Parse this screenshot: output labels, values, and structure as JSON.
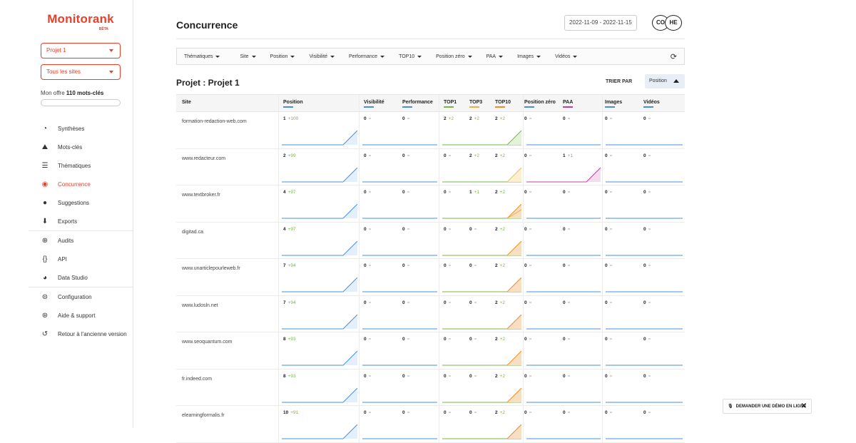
{
  "brand": {
    "name": "Monitorank",
    "badge": "BÊTA",
    "accent": "#e8402a"
  },
  "sidebar": {
    "project_select": "Projet 1",
    "sites_select": "Tous les sites",
    "offer_prefix": "Mon offre",
    "offer_value": "110 mots-clés",
    "items": [
      {
        "label": "Synthèses",
        "icon": "gauge-icon"
      },
      {
        "label": "Mots-clés",
        "icon": "mountain-icon"
      },
      {
        "label": "Thématiques",
        "icon": "layers-icon"
      },
      {
        "label": "Concurrence",
        "icon": "binoculars-icon",
        "active": true
      },
      {
        "label": "Suggestions",
        "icon": "lightbulb-icon"
      },
      {
        "label": "Exports",
        "icon": "download-icon"
      },
      {
        "label": "Audits",
        "icon": "crosshair-icon"
      },
      {
        "label": "API",
        "icon": "braces-icon"
      },
      {
        "label": "Data Studio",
        "icon": "pie-chart-icon"
      },
      {
        "label": "Configuration",
        "icon": "toggles-icon"
      },
      {
        "label": "Aide & support",
        "icon": "lifebuoy-icon"
      },
      {
        "label": "Retour à l'ancienne version",
        "icon": "undo-icon"
      }
    ]
  },
  "header": {
    "title": "Concurrence",
    "date_range": "2022-11-09 - 2022-11-15",
    "avatars": [
      "CO",
      "HE"
    ]
  },
  "filters": [
    "Thématiques",
    "Site",
    "Position",
    "Visibilité",
    "Performance",
    "TOP10",
    "Position zéro",
    "PAA",
    "Images",
    "Vidéos"
  ],
  "project": {
    "title": "Projet : Projet 1",
    "sort_label": "TRIER PAR",
    "sort_value": "Position"
  },
  "table": {
    "columns": [
      {
        "label": "Site",
        "color": ""
      },
      {
        "label": "Position",
        "color": "#4a90d9"
      },
      {
        "label": "Visibilité",
        "color": "#4a90d9"
      },
      {
        "label": "Performance",
        "color": "#4a90d9"
      },
      {
        "label": "TOP1",
        "color": "#7ab648"
      },
      {
        "label": "TOP3",
        "color": "#e8b04a"
      },
      {
        "label": "TOP10",
        "color": "#e8902a"
      },
      {
        "label": "Position zéro",
        "color": "#4a90d9"
      },
      {
        "label": "PAA",
        "color": "#c040a0"
      },
      {
        "label": "Images",
        "color": "#4a90d9"
      },
      {
        "label": "Vidéos",
        "color": "#4a90d9"
      }
    ],
    "rows": [
      {
        "site": "formation-redaction-web.com",
        "position": "1",
        "position_delta": "+100",
        "visibilite": "0",
        "performance": "0",
        "top1": "2",
        "top1_delta": "+2",
        "top3": "2",
        "top3_delta": "+2",
        "top10": "2",
        "top10_delta": "+2",
        "pos0": "0",
        "paa": "0",
        "paa_delta": "",
        "images": "0",
        "videos": "0",
        "top_fill": "green"
      },
      {
        "site": "www.redacteur.com",
        "position": "2",
        "position_delta": "+99",
        "visibilite": "0",
        "performance": "0",
        "top1": "0",
        "top1_delta": "",
        "top3": "2",
        "top3_delta": "+2",
        "top10": "2",
        "top10_delta": "+2",
        "pos0": "0",
        "paa": "1",
        "paa_delta": "+1",
        "images": "0",
        "videos": "0",
        "top_fill": "yellow"
      },
      {
        "site": "www.textbroker.fr",
        "position": "4",
        "position_delta": "+97",
        "visibilite": "0",
        "performance": "0",
        "top1": "0",
        "top1_delta": "",
        "top3": "1",
        "top3_delta": "+1",
        "top10": "2",
        "top10_delta": "+2",
        "pos0": "0",
        "paa": "0",
        "paa_delta": "",
        "images": "0",
        "videos": "0",
        "top_fill": "orange2"
      },
      {
        "site": "digitad.ca",
        "position": "4",
        "position_delta": "+97",
        "visibilite": "0",
        "performance": "0",
        "top1": "0",
        "top1_delta": "",
        "top3": "0",
        "top3_delta": "",
        "top10": "2",
        "top10_delta": "+2",
        "pos0": "0",
        "paa": "0",
        "paa_delta": "",
        "images": "0",
        "videos": "0",
        "top_fill": "orange"
      },
      {
        "site": "www.unarticlepourleweb.fr",
        "position": "7",
        "position_delta": "+94",
        "visibilite": "0",
        "performance": "0",
        "top1": "0",
        "top1_delta": "",
        "top3": "0",
        "top3_delta": "",
        "top10": "2",
        "top10_delta": "+2",
        "pos0": "0",
        "paa": "0",
        "paa_delta": "",
        "images": "0",
        "videos": "0",
        "top_fill": "orange"
      },
      {
        "site": "www.ludosln.net",
        "position": "7",
        "position_delta": "+94",
        "visibilite": "0",
        "performance": "0",
        "top1": "0",
        "top1_delta": "",
        "top3": "0",
        "top3_delta": "",
        "top10": "2",
        "top10_delta": "+2",
        "pos0": "0",
        "paa": "0",
        "paa_delta": "",
        "images": "0",
        "videos": "0",
        "top_fill": "orange"
      },
      {
        "site": "www.seoquantum.com",
        "position": "8",
        "position_delta": "+93",
        "visibilite": "0",
        "performance": "0",
        "top1": "0",
        "top1_delta": "",
        "top3": "0",
        "top3_delta": "",
        "top10": "2",
        "top10_delta": "+2",
        "pos0": "0",
        "paa": "0",
        "paa_delta": "",
        "images": "0",
        "videos": "0",
        "top_fill": "orange"
      },
      {
        "site": "fr.indeed.com",
        "position": "8",
        "position_delta": "+93",
        "visibilite": "0",
        "performance": "0",
        "top1": "0",
        "top1_delta": "",
        "top3": "0",
        "top3_delta": "",
        "top10": "2",
        "top10_delta": "+2",
        "pos0": "0",
        "paa": "0",
        "paa_delta": "",
        "images": "0",
        "videos": "0",
        "top_fill": "orange"
      },
      {
        "site": "elearningformalis.fr",
        "position": "10",
        "position_delta": "+91",
        "visibilite": "0",
        "performance": "0",
        "top1": "0",
        "top1_delta": "",
        "top3": "0",
        "top3_delta": "",
        "top10": "2",
        "top10_delta": "+2",
        "pos0": "0",
        "paa": "0",
        "paa_delta": "",
        "images": "0",
        "videos": "0",
        "top_fill": "orange"
      }
    ]
  },
  "demo_button": {
    "label": "DEMANDER UNE DÉMO EN LIGNE",
    "close": "✕"
  }
}
